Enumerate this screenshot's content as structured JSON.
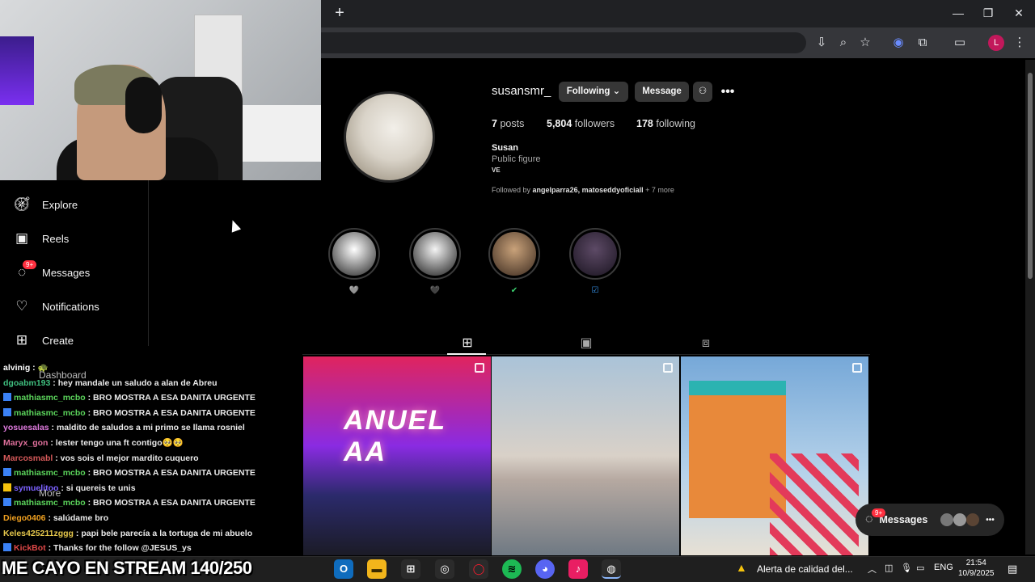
{
  "browser": {
    "new_tab_symbol": "+",
    "window_controls": [
      "—",
      "❐",
      "✕"
    ],
    "profile_initial": "L"
  },
  "nav": {
    "items": [
      {
        "label": "Explore",
        "icon": "compass-icon"
      },
      {
        "label": "Reels",
        "icon": "reels-icon"
      },
      {
        "label": "Messages",
        "icon": "messenger-icon",
        "badge": "9+"
      },
      {
        "label": "Notifications",
        "icon": "heart-icon"
      },
      {
        "label": "Create",
        "icon": "plus-square-icon"
      }
    ],
    "overlap_labels": [
      "Dashboard",
      "More"
    ]
  },
  "profile": {
    "username": "susansmr_",
    "following_btn": "Following",
    "message_btn": "Message",
    "more_dots": "•••",
    "stats": {
      "posts_count": "7",
      "posts_label": "posts",
      "followers_count": "5,804",
      "followers_label": "followers",
      "following_count": "178",
      "following_label": "following"
    },
    "bio_name": "Susan",
    "bio_category": "Public figure",
    "bio_flag": "VE",
    "followed_prefix": "Followed by",
    "followed_users": "angelparra26, matoseddyoficiall",
    "followed_more": "+ 7 more"
  },
  "highlights": [
    {
      "label": "🩶",
      "colors": [
        "#ffffff",
        "#222222"
      ]
    },
    {
      "label": "🖤",
      "colors": [
        "#f4f4f4",
        "#1a1a1a"
      ]
    },
    {
      "label": "✔",
      "colors": [
        "#c9a27a",
        "#3b2a1f"
      ]
    },
    {
      "label": "☑",
      "colors": [
        "#5d4a66",
        "#1a1420"
      ]
    }
  ],
  "posts": {
    "post1_sign": "ANUEL AA"
  },
  "chat": {
    "lines": [
      {
        "user": "alvinig",
        "msg": "🐢",
        "color": "#ffffff",
        "badge": ""
      },
      {
        "user": "dgoabm193",
        "msg": "hey mandale un saludo a alan de Abreu",
        "color": "#3fbf7f",
        "badge": ""
      },
      {
        "user": "mathiasmc_mcbo",
        "msg": "BRO MOSTRA A ESA DANITA URGENTE",
        "color": "#5bd45b",
        "badge": "b"
      },
      {
        "user": "mathiasmc_mcbo",
        "msg": "BRO MOSTRA A ESA DANITA URGENTE",
        "color": "#5bd45b",
        "badge": "b"
      },
      {
        "user": "yosuesalas",
        "msg": "maldito de saludos a mi primo se llama rosniel",
        "color": "#e07bdf",
        "badge": ""
      },
      {
        "user": "Maryx_gon",
        "msg": "lester tengo una ft contigo🥺🥺",
        "color": "#e0709c",
        "badge": ""
      },
      {
        "user": "Marcosmabl",
        "msg": "vos sois el mejor mardito cuquero",
        "color": "#d65a5a",
        "badge": ""
      },
      {
        "user": "mathiasmc_mcbo",
        "msg": "BRO MOSTRA A ESA DANITA URGENTE",
        "color": "#5bd45b",
        "badge": "b"
      },
      {
        "user": "symuelitoo",
        "msg": "si quereis te unis",
        "color": "#7b61ff",
        "badge": "y"
      },
      {
        "user": "mathiasmc_mcbo",
        "msg": "BRO MOSTRA A ESA DANITA URGENTE",
        "color": "#5bd45b",
        "badge": "b"
      },
      {
        "user": "Diego0406",
        "msg": "salúdame bro",
        "color": "#f0a020",
        "badge": ""
      },
      {
        "user": "Keles425211zggg",
        "msg": "papi bele parecía a la tortuga de mi abuelo",
        "color": "#e6c84c",
        "badge": ""
      },
      {
        "user": "KickBot",
        "msg": "Thanks for the follow @JESUS_ys",
        "color": "#e04848",
        "badge": "b"
      }
    ]
  },
  "banner": "ME CAYO EN STREAM 140/250",
  "messages_pill": {
    "label": "Messages",
    "badge": "9+"
  },
  "taskbar": {
    "notification": "Alerta de calidad del...",
    "lang": "ENG",
    "time": "21:54",
    "date": "10/9/2025"
  }
}
